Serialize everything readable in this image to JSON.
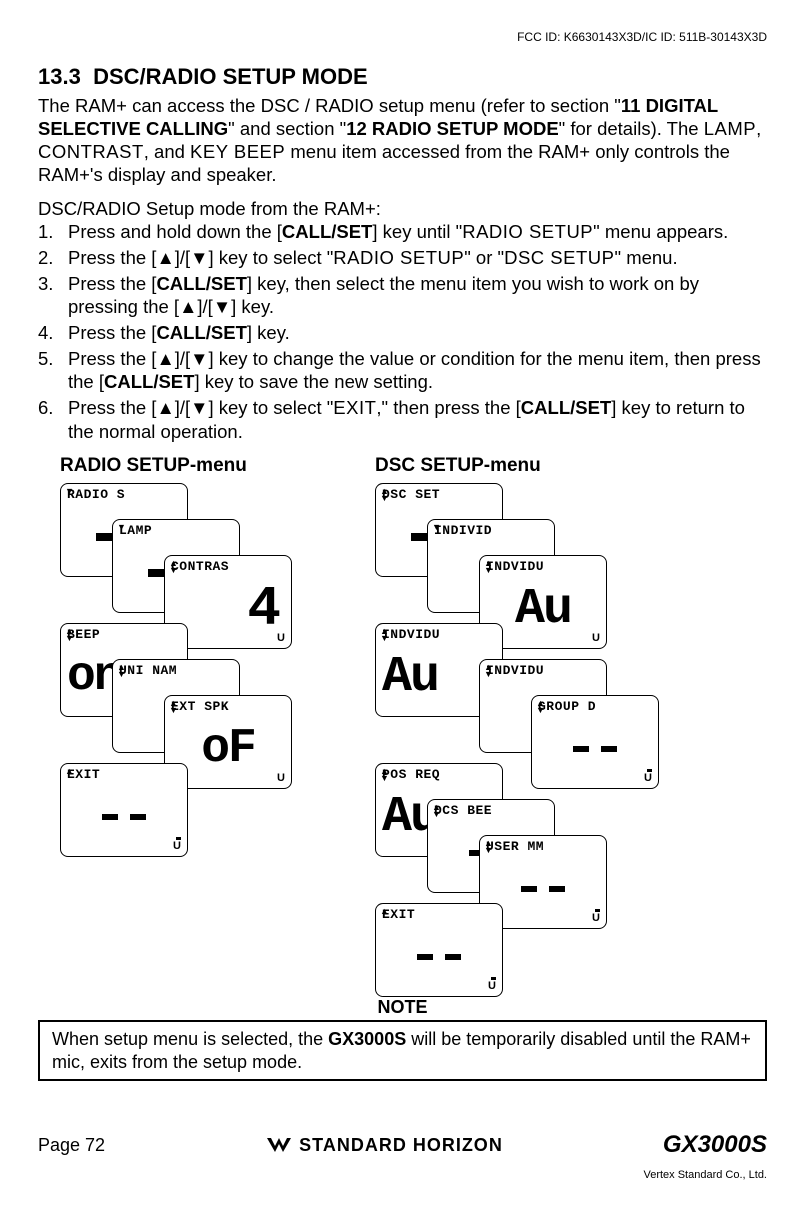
{
  "header": {
    "fcc": "FCC ID: K6630143X3D/IC ID: 511B-30143X3D"
  },
  "section": {
    "number": "13.3",
    "title": "DSC/RADIO SETUP MODE"
  },
  "intro": {
    "p1a": "The RAM+ can access the DSC / RADIO setup menu (refer to section \"",
    "p1b": "11 DIGITAL SELECTIVE CALLING",
    "p1c": "\" and section \"",
    "p1d": "12 RADIO SETUP MODE",
    "p1e": "\" for details). The ",
    "p1f": "LAMP",
    "p1g": ", ",
    "p1h": "CONTRAST",
    "p1i": ", and ",
    "p1j": "KEY BEEP",
    "p1k": " menu item accessed from the RAM+ only controls the RAM+'s display and speaker."
  },
  "procedure": {
    "lead": "DSC/RADIO Setup mode from the RAM+:",
    "items": [
      {
        "n": "1.",
        "pre": "Press and hold down the [",
        "bold": "CALL/SET",
        "post": "] key until \"",
        "lcd": "RADIO SETUP",
        "tail": "\" menu appears."
      },
      {
        "n": "2.",
        "pre": "Press the [",
        "sym1": "▲",
        "mid": "]/[",
        "sym2": "▼",
        "post": "] key to select \"",
        "lcd1": "RADIO SETUP",
        "mid2": "\" or \"",
        "lcd2": "DSC SETUP",
        "tail": "\" menu."
      },
      {
        "n": "3.",
        "pre": "Press the [",
        "bold": "CALL/SET",
        "post": "] key, then select the menu item you wish to work on by pressing the [",
        "sym1": "▲",
        "mid": "]/[",
        "sym2": "▼",
        "tail": "] key."
      },
      {
        "n": "4.",
        "pre": "Press the [",
        "bold": "CALL/SET",
        "tail": "] key."
      },
      {
        "n": "5.",
        "pre": "Press the [",
        "sym1": "▲",
        "mid": "]/[",
        "sym2": "▼",
        "post": "] key to change the value or condition for the menu item, then press the [",
        "bold": "CALL/SET",
        "tail": "] key to save the new setting."
      },
      {
        "n": "6.",
        "pre": "Press the [",
        "sym1": "▲",
        "mid": "]/[",
        "sym2": "▼",
        "post": "] key to select \"",
        "lcd": "EXIT",
        "post2": ",\" then press the [",
        "bold": "CALL/SET",
        "tail": "] key to return to the normal operation."
      }
    ]
  },
  "menus": {
    "radio": {
      "title": "RADIO SETUP-menu",
      "cards": {
        "c1": "RADIO S",
        "c2": "LAMP",
        "c3": "CONTRAS",
        "c3big": "4",
        "c4": "BEEP",
        "c4big": "on",
        "c5": "UNI NAM",
        "c6": "EXT SPK",
        "c6big": "oF",
        "c7": "EXIT"
      }
    },
    "dsc": {
      "title": "DSC SETUP-menu",
      "cards": {
        "d1": "DSC SET",
        "d2": "INDIVID",
        "d3": "INDVIDU",
        "d3big": "Au",
        "d4": "INDVIDU",
        "d4big": "Au",
        "d5": "INDVIDU",
        "d6": "GROUP D",
        "d7": "POS REQ",
        "d7big": "Au",
        "d8": "DCS BEE",
        "d9": "USER MM",
        "d10": "EXIT"
      }
    }
  },
  "note": {
    "label": "NOTE",
    "t1": "When setup menu is selected, the ",
    "bold": "GX3000S",
    "t2": " will be temporarily disabled until the RAM+ mic, exits from the setup mode."
  },
  "footer": {
    "page": "Page 72",
    "brand": "STANDARD HORIZON",
    "model": "GX3000S",
    "copyright": "Vertex Standard Co., Ltd."
  }
}
